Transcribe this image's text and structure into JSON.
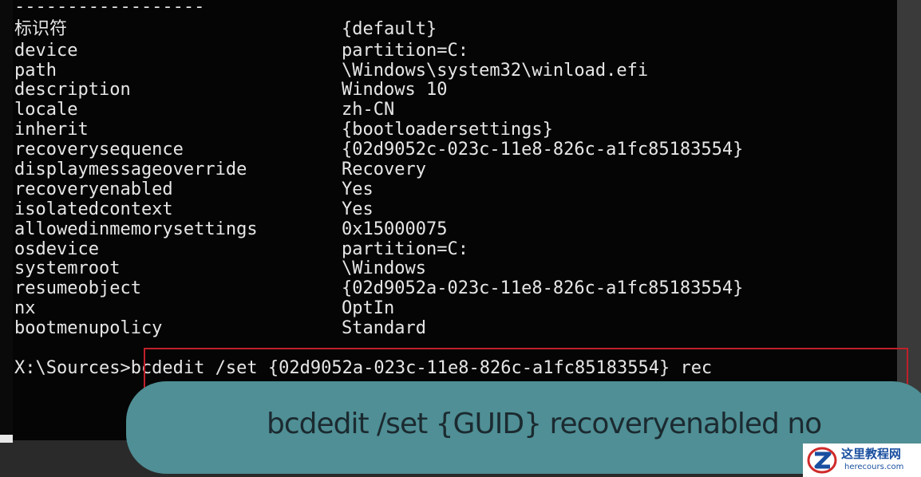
{
  "console": {
    "dashes": "------------------",
    "entries": [
      {
        "key": "标识符",
        "value": "{default}"
      },
      {
        "key": "device",
        "value": "partition=C:"
      },
      {
        "key": "path",
        "value": "\\Windows\\system32\\winload.efi"
      },
      {
        "key": "description",
        "value": "Windows 10"
      },
      {
        "key": "locale",
        "value": "zh-CN"
      },
      {
        "key": "inherit",
        "value": "{bootloadersettings}"
      },
      {
        "key": "recoverysequence",
        "value": "{02d9052c-023c-11e8-826c-a1fc85183554}"
      },
      {
        "key": "displaymessageoverride",
        "value": "Recovery"
      },
      {
        "key": "recoveryenabled",
        "value": "Yes"
      },
      {
        "key": "isolatedcontext",
        "value": "Yes"
      },
      {
        "key": "allowedinmemorysettings",
        "value": "0x15000075"
      },
      {
        "key": "osdevice",
        "value": "partition=C:"
      },
      {
        "key": "systemroot",
        "value": "\\Windows"
      },
      {
        "key": "resumeobject",
        "value": "{02d9052a-023c-11e8-826c-a1fc85183554}"
      },
      {
        "key": "nx",
        "value": "OptIn"
      },
      {
        "key": "bootmenupolicy",
        "value": "Standard"
      }
    ],
    "command_line": "X:\\Sources>bcdedit /set {02d9052a-023c-11e8-826c-a1fc85183554} rec"
  },
  "caption": {
    "text": "bcdedit /set {GUID} recoveryenabled no"
  },
  "watermark": {
    "title": "这里教程网",
    "url": "herecours.com",
    "icon": "z-logo-icon"
  },
  "colors": {
    "console_bg": "#050505",
    "console_text": "#e6e6e6",
    "highlight_border": "#c0202a",
    "caption_bg": "#4f8f95",
    "logo_blue": "#1a4fa0"
  }
}
